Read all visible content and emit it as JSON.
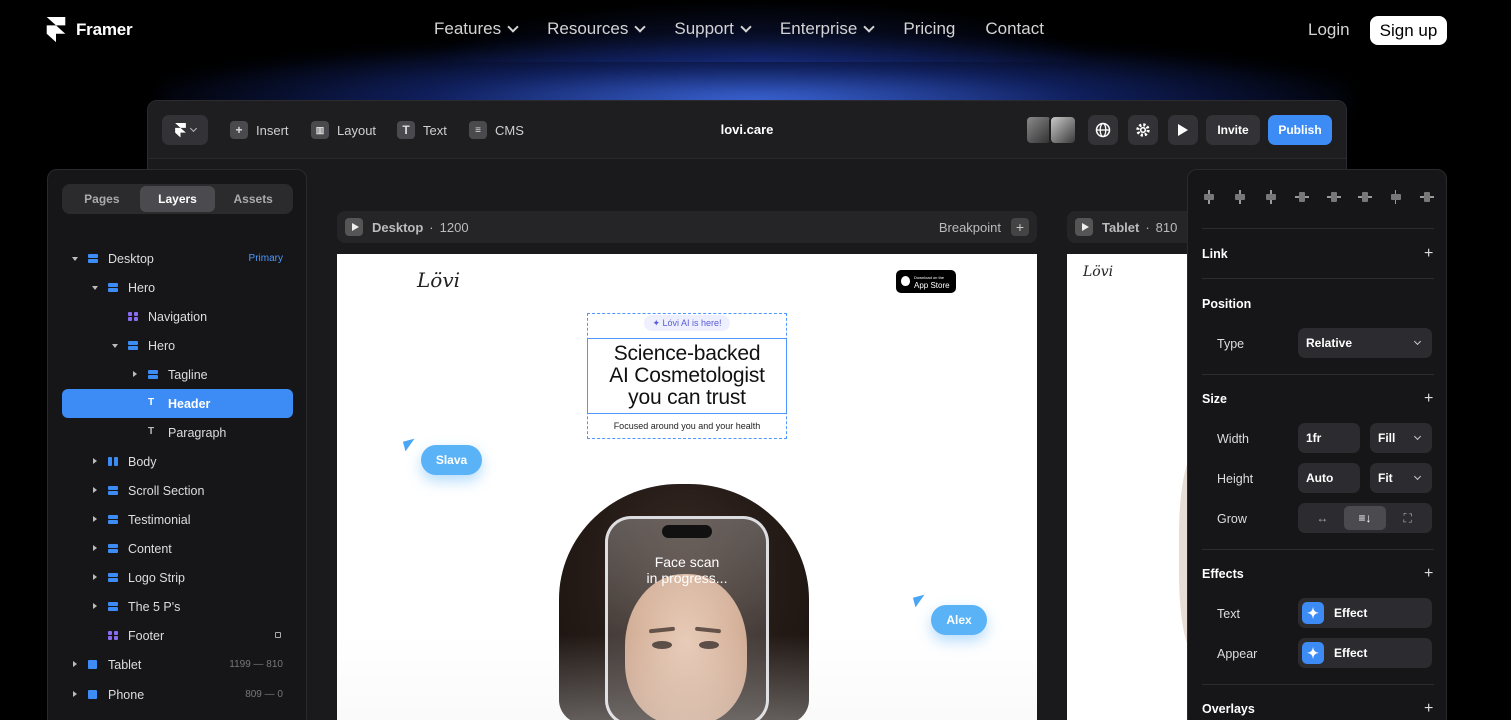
{
  "site": {
    "brand": "Framer",
    "menu": [
      {
        "label": "Features",
        "has_dropdown": true
      },
      {
        "label": "Resources",
        "has_dropdown": true
      },
      {
        "label": "Support",
        "has_dropdown": true
      },
      {
        "label": "Enterprise",
        "has_dropdown": true
      },
      {
        "label": "Pricing",
        "has_dropdown": false
      },
      {
        "label": "Contact",
        "has_dropdown": false
      }
    ],
    "login": "Login",
    "signup": "Sign up"
  },
  "toolbar": {
    "insert": "Insert",
    "layout": "Layout",
    "text": "Text",
    "cms": "CMS",
    "project_title": "lovi.care",
    "invite": "Invite",
    "publish": "Publish"
  },
  "left_panel": {
    "tabs": [
      "Pages",
      "Layers",
      "Assets"
    ],
    "active_tab": "Layers",
    "layers": [
      {
        "name": "Desktop",
        "meta": "Primary"
      },
      {
        "name": "Hero",
        "meta": ""
      },
      {
        "name": "Navigation",
        "meta": ""
      },
      {
        "name": "Hero",
        "meta": ""
      },
      {
        "name": "Tagline",
        "meta": ""
      },
      {
        "name": "Header",
        "meta": ""
      },
      {
        "name": "Paragraph",
        "meta": ""
      },
      {
        "name": "Body",
        "meta": ""
      },
      {
        "name": "Scroll Section",
        "meta": ""
      },
      {
        "name": "Testimonial",
        "meta": ""
      },
      {
        "name": "Content",
        "meta": ""
      },
      {
        "name": "Logo Strip",
        "meta": ""
      },
      {
        "name": "The 5 P's",
        "meta": ""
      },
      {
        "name": "Footer",
        "meta": ""
      },
      {
        "name": "Tablet",
        "meta": "1199 — 810"
      },
      {
        "name": "Phone",
        "meta": "809 — 0"
      }
    ]
  },
  "canvas": {
    "desktop": {
      "name": "Desktop",
      "sep": "·",
      "width": "1200",
      "breakpoint": "Breakpoint"
    },
    "tablet": {
      "name": "Tablet",
      "sep": "·",
      "width": "810"
    },
    "site": {
      "logo": "Lövi",
      "store_small": "Download on the",
      "store_big": "App Store",
      "badge": "✦ Lóvi AI is here!",
      "headline_1": "Science-backed",
      "headline_2": "AI Cosmetologist",
      "headline_3": "you can trust",
      "subline": "Focused around you and your health",
      "scan_1": "Face scan",
      "scan_2": "in progress..."
    },
    "cursors": [
      {
        "name": "Slava",
        "color": "#5ab2f7"
      },
      {
        "name": "Alex",
        "color": "#5ab2f7"
      }
    ]
  },
  "right_panel": {
    "link": "Link",
    "position": "Position",
    "type_label": "Type",
    "type_value": "Relative",
    "size": "Size",
    "width_label": "Width",
    "width_value": "1fr",
    "width_mode": "Fill",
    "height_label": "Height",
    "height_value": "Auto",
    "height_mode": "Fit",
    "grow_label": "Grow",
    "effects": "Effects",
    "text_label": "Text",
    "appear_label": "Appear",
    "effect": "Effect",
    "overlays": "Overlays"
  },
  "colors": {
    "accent": "#3d8bf5",
    "background": "#000000",
    "panel": "#161618"
  }
}
